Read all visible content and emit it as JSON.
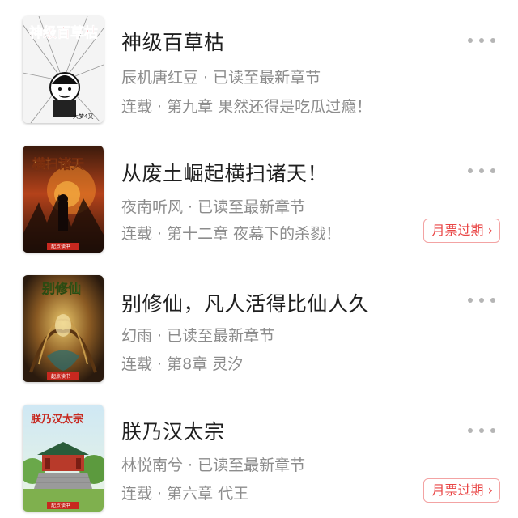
{
  "books": [
    {
      "title": "神级百草枯",
      "author_line": "辰机唐红豆 · 已读至最新章节",
      "status_line": "连载 · 第九章 果然还得是吃瓜过瘾！",
      "badge": null,
      "cover_title": "神级百草枯",
      "cover_author": "大梦4又"
    },
    {
      "title": "从废土崛起横扫诸天！",
      "author_line": "夜南听风 · 已读至最新章节",
      "status_line": "连载 · 第十二章 夜幕下的杀戮！",
      "badge": "月票过期 ›",
      "cover_title": "横扫诸天",
      "cover_publisher": "起点读书"
    },
    {
      "title": "别修仙，凡人活得比仙人久",
      "author_line": "幻雨 · 已读至最新章节",
      "status_line": "连载 · 第8章 灵汐",
      "badge": null,
      "cover_title": "别修仙",
      "cover_publisher": "起点读书"
    },
    {
      "title": "朕乃汉太宗",
      "author_line": "林悦南兮 · 已读至最新章节",
      "status_line": "连载 · 第六章 代王",
      "badge": "月票过期 ›",
      "cover_title": "朕乃汉太宗",
      "cover_publisher": "起点读书"
    }
  ],
  "colors": {
    "title": "#1f1f1f",
    "meta": "#8c8c8c",
    "badge": "#e94545",
    "badge_border": "#f3a3a3",
    "dots": "#b5b5b5"
  },
  "icons": {
    "more": "more-dots-icon"
  }
}
